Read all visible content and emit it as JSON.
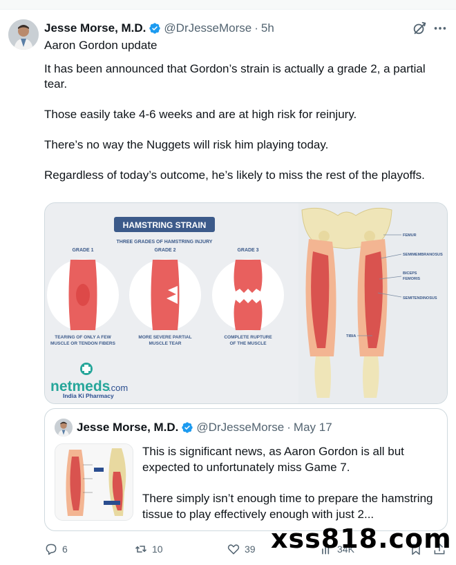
{
  "tweet": {
    "author_name": "Jesse Morse, M.D.",
    "handle": "@DrJesseMorse",
    "separator": "·",
    "time": "5h",
    "paragraphs": [
      "Aaron Gordon update",
      "It has been announced that Gordon’s strain is actually a grade 2, a partial tear.",
      "Those easily take 4-6 weeks and are at high risk for reinjury.",
      "There’s no way the Nuggets will risk him playing today.",
      "Regardless of today’s outcome, he’s likely to miss the rest of the playoffs."
    ]
  },
  "media_image": {
    "title": "HAMSTRING STRAIN",
    "subtitle": "THREE GRADES OF HAMSTRING INJURY",
    "grades": [
      {
        "label": "GRADE 1",
        "caption1": "TEARING OF ONLY A FEW",
        "caption2": "MUSCLE OR TENDON FIBERS"
      },
      {
        "label": "GRADE 2",
        "caption1": "MORE SEVERE PARTIAL",
        "caption2": "MUSCLE TEAR"
      },
      {
        "label": "GRADE 3",
        "caption1": "COMPLETE RUPTURE",
        "caption2": "OF THE MUSCLE"
      }
    ],
    "anatomy_labels": [
      "FEMUR",
      "SEMIMEMBRANOSUS",
      "BICEPS",
      "FEMORIS",
      "SEMITENDINOSUS",
      "TIBIA"
    ],
    "brand": "netmeds",
    "brand_suffix": ".com",
    "tagline": "India Ki Pharmacy"
  },
  "quoted_tweet": {
    "author_name": "Jesse Morse, M.D.",
    "handle": "@DrJesseMorse",
    "separator": "·",
    "date": "May 17",
    "paragraphs": [
      "This is significant news, as Aaron Gordon is all but expected to unfortunately miss Game 7.",
      "There simply isn’t enough time to prepare the hamstring tissue to play effectively enough with just 2..."
    ]
  },
  "actions": {
    "replies": "6",
    "reposts": "10",
    "likes": "39",
    "views": "34K"
  },
  "watermark": "xss818.com",
  "colors": {
    "verified_blue": "#1d9bf0",
    "text_primary": "#0f1419",
    "text_secondary": "#536471",
    "border": "#cfd9de",
    "muscle_red": "#e8605e",
    "brand_green": "#26a69a",
    "brand_blue": "#2a4d8f"
  }
}
